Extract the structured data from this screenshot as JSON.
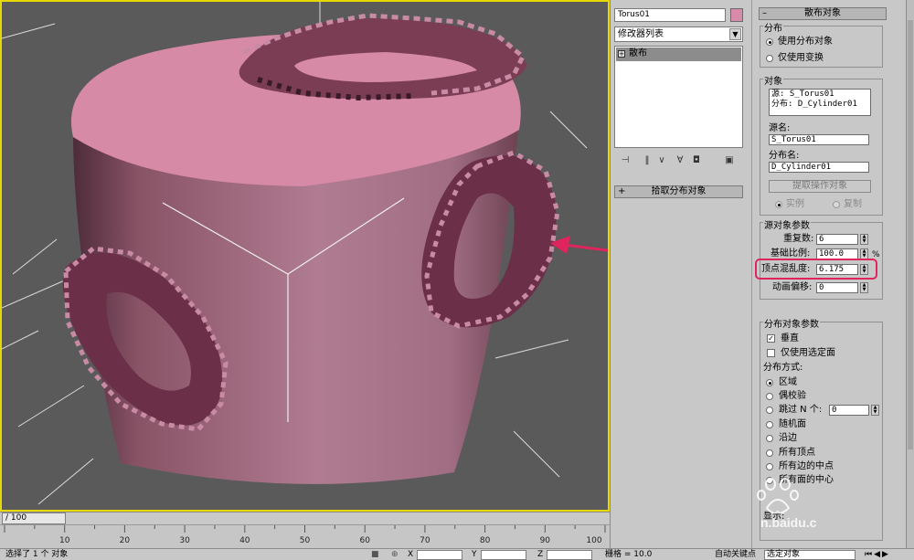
{
  "panel": {
    "object_name": "Torus01",
    "object_color": "#d88aaa",
    "modifier_list": "修改器列表",
    "stack_item": "散布",
    "pick_rollout": "拾取分布对象"
  },
  "scatter": {
    "rollout_title": "散布对象",
    "distribution": {
      "title": "分布",
      "options": [
        "使用分布对象",
        "仅使用变换"
      ],
      "selected": 0
    },
    "objects": {
      "title": "对象",
      "list": [
        "源: S_Torus01",
        "分布: D_Cylinder01"
      ],
      "source_name_label": "源名:",
      "source_name": "S_Torus01",
      "dist_name_label": "分布名:",
      "dist_name": "D_Cylinder01",
      "extract_button": "提取操作对象",
      "instance": "实例",
      "copy": "复制"
    },
    "source_params": {
      "title": "源对象参数",
      "duplicates_label": "重复数:",
      "duplicates": "6",
      "base_scale_label": "基础比例:",
      "base_scale": "100.0",
      "percent": "%",
      "vertex_chaos_label": "顶点混乱度:",
      "vertex_chaos": "6.175",
      "anim_offset_label": "动画偏移:",
      "anim_offset": "0"
    },
    "dist_params": {
      "title": "分布对象参数",
      "perpendicular": "垂直",
      "use_selected": "仅使用选定面",
      "method_label": "分布方式:",
      "methods": [
        "区域",
        "偶校验",
        "跳过 N 个:",
        "随机面",
        "沿边",
        "所有顶点",
        "所有边的中点",
        "所有面的中心"
      ],
      "skip_n": "0",
      "display_label": "显示:"
    }
  },
  "timeline": {
    "counter": "/ 100",
    "ticks": [
      "10",
      "20",
      "30",
      "40",
      "50",
      "60",
      "70",
      "80",
      "90",
      "100"
    ]
  },
  "status": {
    "selection": "选择了 1 个 对象",
    "x_label": "X",
    "y_label": "Y",
    "z_label": "Z",
    "grid": "栅格 = 10.0",
    "autokey": "自动关键点",
    "selection_set": "选定对象"
  },
  "watermark": {
    "text": "n.baidu.c"
  },
  "colors": {
    "viewport_border": "#e6d800",
    "highlight": "#e0245e",
    "cylinder": "#b97a93"
  }
}
